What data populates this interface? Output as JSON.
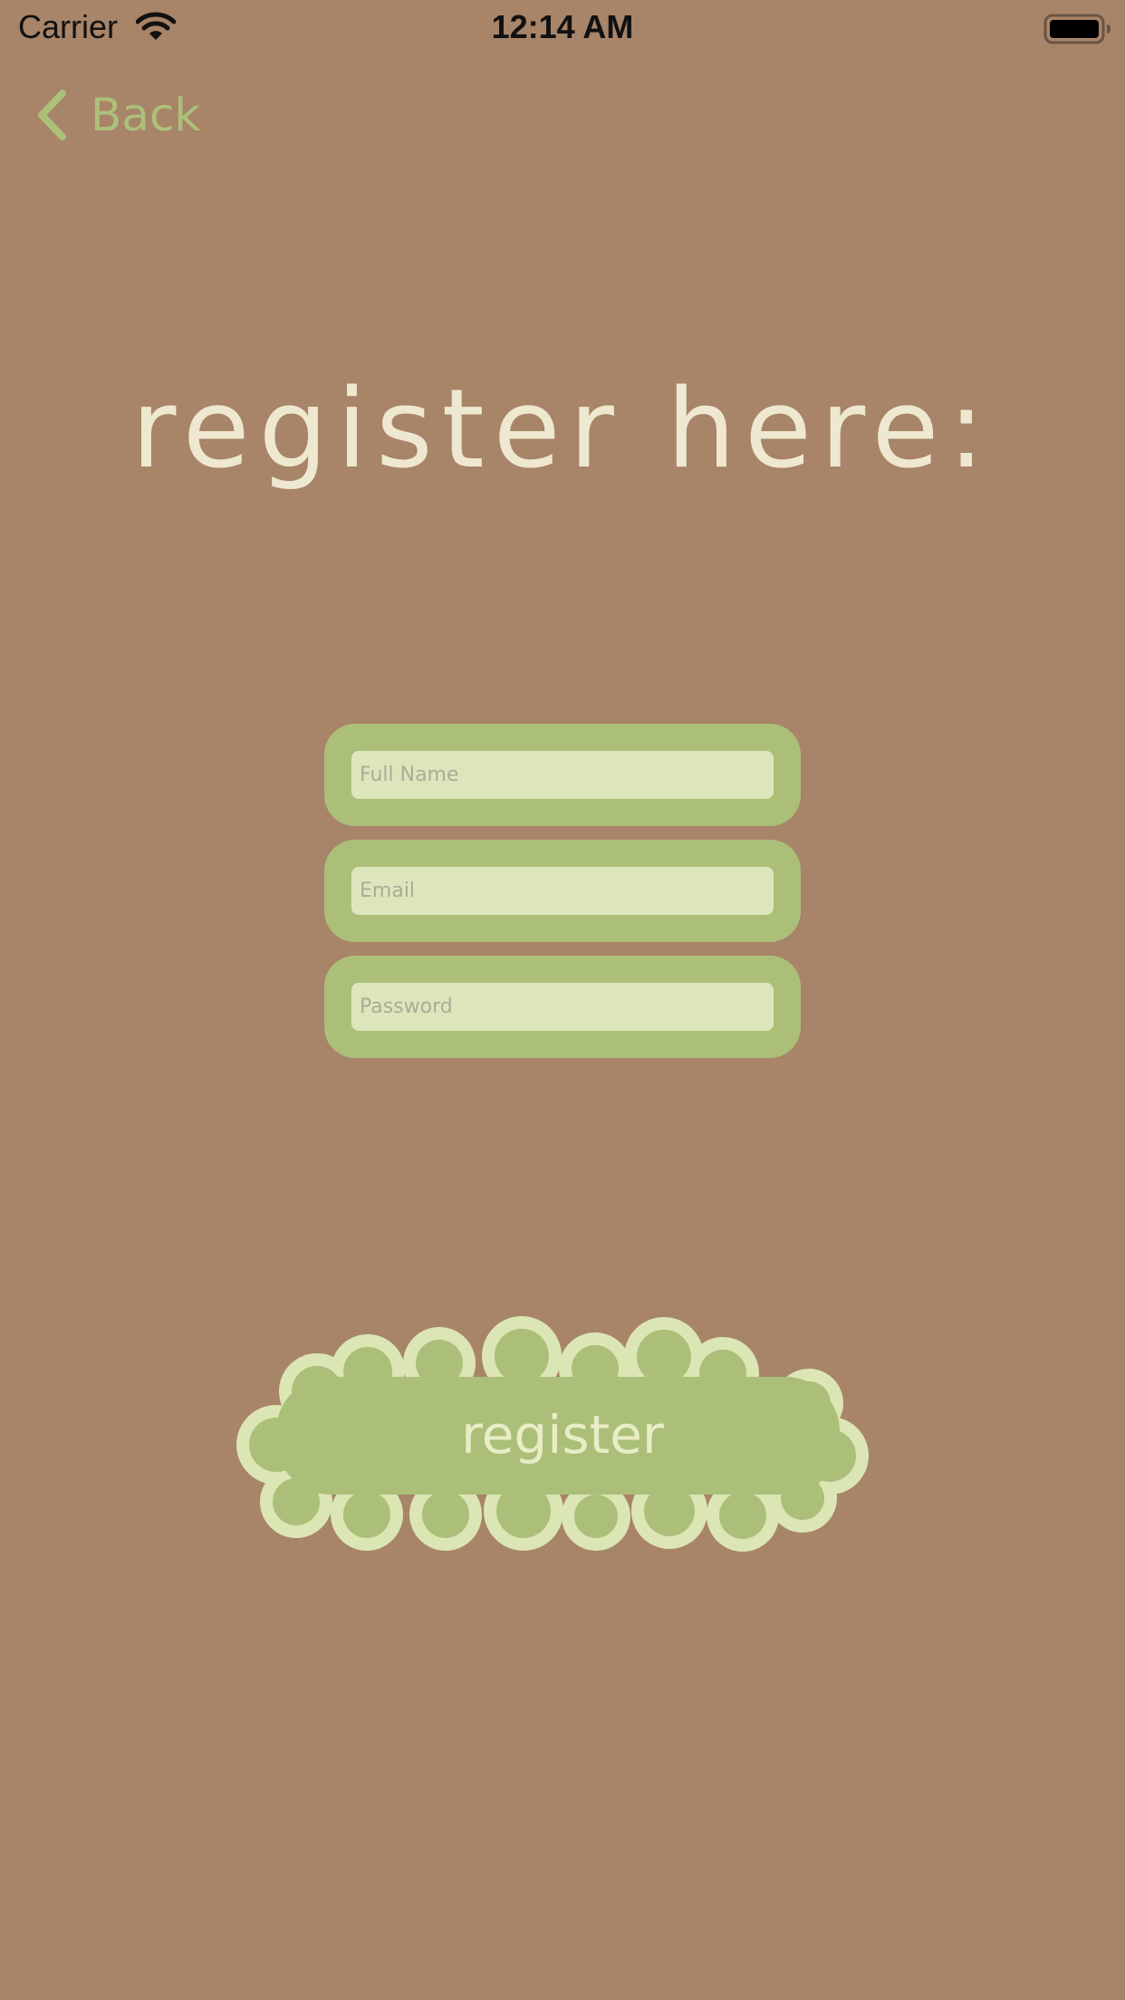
{
  "status_bar": {
    "carrier": "Carrier",
    "time": "12:14 AM",
    "icons": [
      "wifi-icon",
      "battery-icon"
    ]
  },
  "nav": {
    "back_label": "Back",
    "back_icon": "chevron-left-icon"
  },
  "title": "register here:",
  "form": {
    "full_name_placeholder": "Full Name",
    "email_placeholder": "Email",
    "password_placeholder": "Password"
  },
  "register_button": {
    "label": "register"
  },
  "colors": {
    "background": "#a88468",
    "accent_green": "#abbf79",
    "input_fill": "#dde6bb",
    "title_text": "#efe8d1",
    "button_outline": "#dbe6b4"
  }
}
